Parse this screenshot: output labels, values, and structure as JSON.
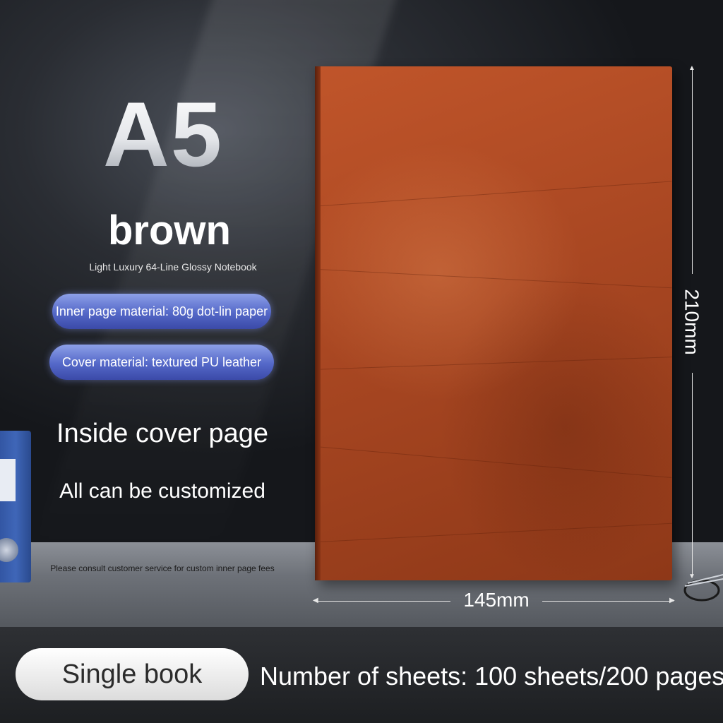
{
  "product": {
    "size": "A5",
    "color": "brown",
    "subtitle": "Light Luxury 64-Line Glossy Notebook"
  },
  "features": [
    {
      "label": "Inner page material: 80g dot-lin paper"
    },
    {
      "label": "Cover material: textured PU leather"
    }
  ],
  "customization": {
    "headline": "Inside cover page",
    "subline": "All can be customized",
    "note": "Please consult customer service for custom inner page fees"
  },
  "dimensions": {
    "height_label": "210mm",
    "width_label": "145mm"
  },
  "footer": {
    "option_label": "Single book",
    "sheets_label": "Number of sheets: 100 sheets/200 pages"
  },
  "colors": {
    "cover": "#a94722",
    "pill_accent": "#5468c8",
    "background": "#1b1d22"
  },
  "icons": [
    "binder-icon",
    "glasses-icon"
  ]
}
